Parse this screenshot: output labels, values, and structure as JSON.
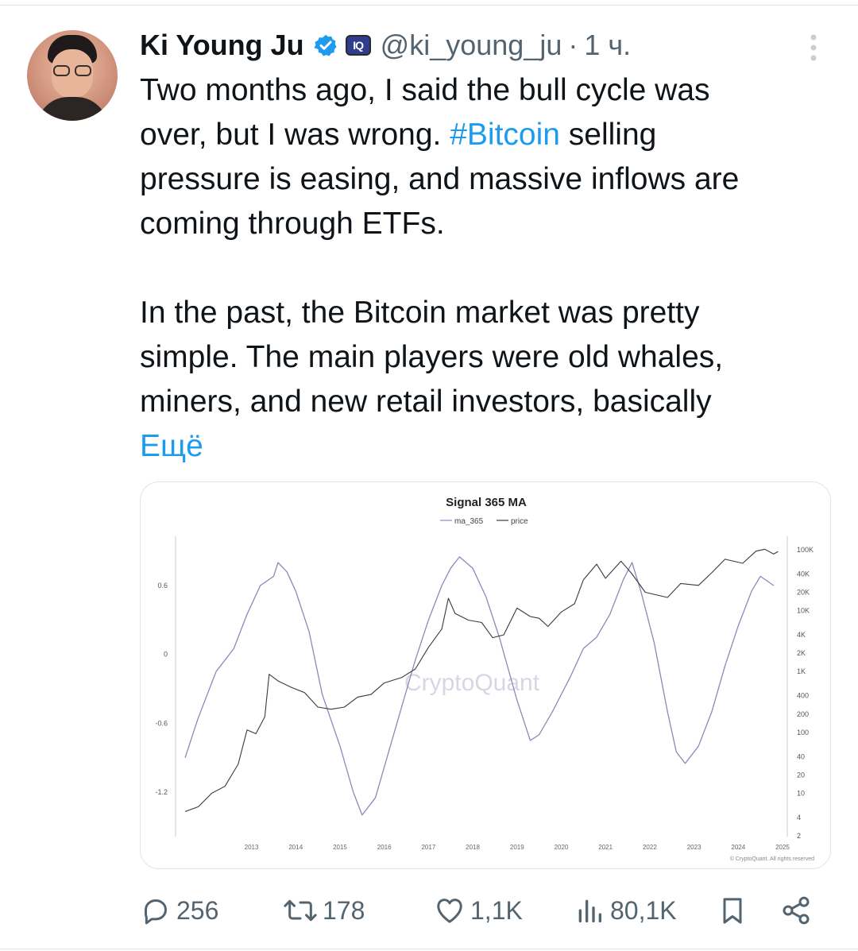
{
  "tweet": {
    "author_name": "Ki Young Ju",
    "handle": "@ki_young_ju",
    "separator": "·",
    "time": "1 ч.",
    "text_lines_p1": [
      "Two months ago, I said the bull cycle was",
      "over, but I was wrong. ",
      "pressure is easing, and massive inflows are",
      "coming through ETFs."
    ],
    "hashtag": "#Bitcoin",
    "after_hashtag": " selling",
    "text_lines_p2": [
      "In the past, the Bitcoin market was pretty",
      "simple. The main players were old whales,",
      "miners, and new retail investors, basically"
    ],
    "show_more": "Ещё",
    "affiliation_badge": "IQ",
    "colors": {
      "link": "#1d9bf0",
      "verified": "#1d9bf0",
      "secondary": "#536471"
    }
  },
  "actions": {
    "replies": "256",
    "retweets": "178",
    "likes": "1,1K",
    "views": "80,1K",
    "icons": [
      "reply-icon",
      "retweet-icon",
      "like-icon",
      "views-icon",
      "bookmark-icon",
      "share-icon"
    ]
  },
  "chart_data": {
    "type": "line",
    "title": "Signal 365 MA",
    "legend": [
      "ma_365",
      "price"
    ],
    "legend_position": "top-center",
    "watermark": "CryptoQuant",
    "copyright": "© CryptoQuant. All rights reserved",
    "x_ticks": [
      "2013",
      "2014",
      "2015",
      "2016",
      "2017",
      "2018",
      "2019",
      "2020",
      "2021",
      "2022",
      "2023",
      "2024",
      "2025"
    ],
    "left_axis_ticks": [
      "0.6",
      "0",
      "-0.6",
      "-1.2"
    ],
    "right_axis_ticks": [
      "100K",
      "40K",
      "20K",
      "10K",
      "4K",
      "2K",
      "1K",
      "400",
      "200",
      "100",
      "40",
      "20",
      "10",
      "4",
      "2"
    ],
    "right_axis_scale": "log",
    "grid": false,
    "series": [
      {
        "name": "ma_365",
        "axis": "left",
        "color": "#8c88b8",
        "points": [
          [
            2012.0,
            -0.9
          ],
          [
            2012.3,
            -0.55
          ],
          [
            2012.7,
            -0.15
          ],
          [
            2013.1,
            0.05
          ],
          [
            2013.4,
            0.35
          ],
          [
            2013.7,
            0.6
          ],
          [
            2014.0,
            0.68
          ],
          [
            2014.1,
            0.8
          ],
          [
            2014.3,
            0.72
          ],
          [
            2014.5,
            0.55
          ],
          [
            2014.8,
            0.2
          ],
          [
            2015.1,
            -0.35
          ],
          [
            2015.5,
            -0.8
          ],
          [
            2015.8,
            -1.2
          ],
          [
            2016.0,
            -1.4
          ],
          [
            2016.3,
            -1.25
          ],
          [
            2016.6,
            -0.85
          ],
          [
            2016.9,
            -0.45
          ],
          [
            2017.2,
            -0.05
          ],
          [
            2017.5,
            0.3
          ],
          [
            2017.8,
            0.6
          ],
          [
            2018.0,
            0.75
          ],
          [
            2018.2,
            0.85
          ],
          [
            2018.5,
            0.75
          ],
          [
            2018.8,
            0.5
          ],
          [
            2019.1,
            0.15
          ],
          [
            2019.5,
            -0.4
          ],
          [
            2019.8,
            -0.75
          ],
          [
            2020.0,
            -0.7
          ],
          [
            2020.3,
            -0.5
          ],
          [
            2020.7,
            -0.2
          ],
          [
            2021.0,
            0.05
          ],
          [
            2021.3,
            0.15
          ],
          [
            2021.6,
            0.35
          ],
          [
            2021.9,
            0.65
          ],
          [
            2022.1,
            0.8
          ],
          [
            2022.3,
            0.55
          ],
          [
            2022.6,
            0.1
          ],
          [
            2022.9,
            -0.5
          ],
          [
            2023.1,
            -0.85
          ],
          [
            2023.3,
            -0.95
          ],
          [
            2023.6,
            -0.8
          ],
          [
            2023.9,
            -0.5
          ],
          [
            2024.2,
            -0.1
          ],
          [
            2024.5,
            0.25
          ],
          [
            2024.8,
            0.55
          ],
          [
            2025.0,
            0.68
          ],
          [
            2025.3,
            0.6
          ]
        ]
      },
      {
        "name": "price",
        "axis": "right",
        "color": "#3a3a3a",
        "points": [
          [
            2012.0,
            5
          ],
          [
            2012.3,
            6
          ],
          [
            2012.6,
            10
          ],
          [
            2012.9,
            13
          ],
          [
            2013.2,
            30
          ],
          [
            2013.4,
            110
          ],
          [
            2013.6,
            95
          ],
          [
            2013.8,
            180
          ],
          [
            2013.9,
            900
          ],
          [
            2014.1,
            700
          ],
          [
            2014.4,
            550
          ],
          [
            2014.7,
            450
          ],
          [
            2015.0,
            260
          ],
          [
            2015.3,
            240
          ],
          [
            2015.6,
            260
          ],
          [
            2015.9,
            380
          ],
          [
            2016.2,
            420
          ],
          [
            2016.5,
            650
          ],
          [
            2016.9,
            800
          ],
          [
            2017.2,
            1100
          ],
          [
            2017.5,
            2500
          ],
          [
            2017.8,
            5000
          ],
          [
            2017.95,
            16000
          ],
          [
            2018.1,
            9000
          ],
          [
            2018.4,
            7000
          ],
          [
            2018.7,
            6400
          ],
          [
            2018.95,
            3600
          ],
          [
            2019.2,
            4000
          ],
          [
            2019.5,
            11000
          ],
          [
            2019.8,
            8000
          ],
          [
            2020.0,
            7500
          ],
          [
            2020.2,
            5500
          ],
          [
            2020.5,
            9500
          ],
          [
            2020.8,
            13000
          ],
          [
            2021.0,
            32000
          ],
          [
            2021.3,
            58000
          ],
          [
            2021.5,
            34000
          ],
          [
            2021.85,
            65000
          ],
          [
            2022.1,
            40000
          ],
          [
            2022.4,
            20000
          ],
          [
            2022.9,
            16500
          ],
          [
            2023.2,
            28000
          ],
          [
            2023.6,
            26000
          ],
          [
            2023.9,
            42000
          ],
          [
            2024.2,
            70000
          ],
          [
            2024.6,
            60000
          ],
          [
            2024.9,
            95000
          ],
          [
            2025.1,
            102000
          ],
          [
            2025.3,
            85000
          ],
          [
            2025.4,
            94000
          ]
        ]
      }
    ]
  }
}
